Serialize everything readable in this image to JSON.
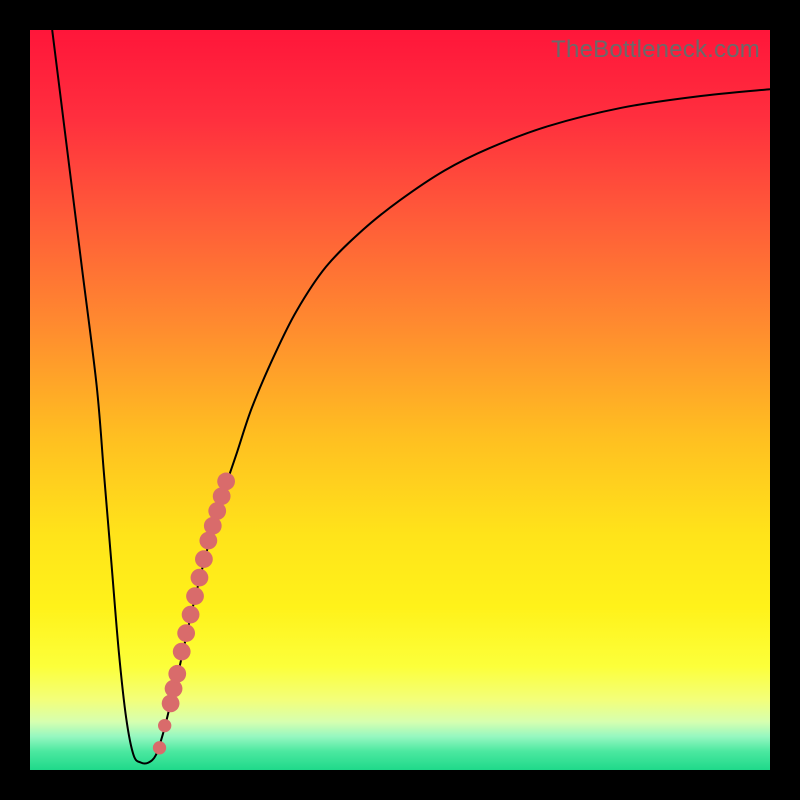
{
  "watermark": "TheBottleneck.com",
  "colors": {
    "frame": "#000000",
    "curve_stroke": "#000000",
    "dot_fill": "#d96b6b",
    "gradient_stops": [
      {
        "offset": 0.0,
        "color": "#ff163a"
      },
      {
        "offset": 0.12,
        "color": "#ff2f3e"
      },
      {
        "offset": 0.25,
        "color": "#ff5a39"
      },
      {
        "offset": 0.4,
        "color": "#ff8b2f"
      },
      {
        "offset": 0.55,
        "color": "#ffbf21"
      },
      {
        "offset": 0.68,
        "color": "#ffe31a"
      },
      {
        "offset": 0.78,
        "color": "#fff21a"
      },
      {
        "offset": 0.86,
        "color": "#fcff3a"
      },
      {
        "offset": 0.905,
        "color": "#f3ff7a"
      },
      {
        "offset": 0.935,
        "color": "#d6ffb0"
      },
      {
        "offset": 0.955,
        "color": "#95f7c0"
      },
      {
        "offset": 0.975,
        "color": "#4be8a0"
      },
      {
        "offset": 1.0,
        "color": "#1fd98a"
      }
    ]
  },
  "chart_data": {
    "type": "line",
    "title": "",
    "xlabel": "",
    "ylabel": "",
    "xlim": [
      0,
      100
    ],
    "ylim": [
      0,
      100
    ],
    "grid": false,
    "series": [
      {
        "name": "bottleneck-curve",
        "x": [
          3,
          5,
          7,
          9,
          10,
          11,
          12,
          13,
          14,
          15,
          16,
          17,
          18,
          19,
          20,
          22,
          24,
          26,
          28,
          30,
          33,
          36,
          40,
          45,
          50,
          56,
          62,
          70,
          80,
          90,
          100
        ],
        "y": [
          100,
          84,
          68,
          52,
          40,
          28,
          16,
          7,
          2,
          1,
          1,
          2,
          5,
          9,
          13,
          22,
          30,
          37,
          43,
          49,
          56,
          62,
          68,
          73,
          77,
          81,
          84,
          87,
          89.5,
          91,
          92
        ]
      }
    ],
    "highlight_dots": {
      "name": "highlighted-segment",
      "points": [
        {
          "x": 17.5,
          "y": 3
        },
        {
          "x": 18.2,
          "y": 6
        },
        {
          "x": 19.0,
          "y": 9
        },
        {
          "x": 19.4,
          "y": 11
        },
        {
          "x": 19.9,
          "y": 13
        },
        {
          "x": 20.5,
          "y": 16
        },
        {
          "x": 21.1,
          "y": 18.5
        },
        {
          "x": 21.7,
          "y": 21
        },
        {
          "x": 22.3,
          "y": 23.5
        },
        {
          "x": 22.9,
          "y": 26
        },
        {
          "x": 23.5,
          "y": 28.5
        },
        {
          "x": 24.1,
          "y": 31
        },
        {
          "x": 24.7,
          "y": 33
        },
        {
          "x": 25.3,
          "y": 35
        },
        {
          "x": 25.9,
          "y": 37
        },
        {
          "x": 26.5,
          "y": 39
        }
      ],
      "radius_data_units": 1.2
    }
  }
}
